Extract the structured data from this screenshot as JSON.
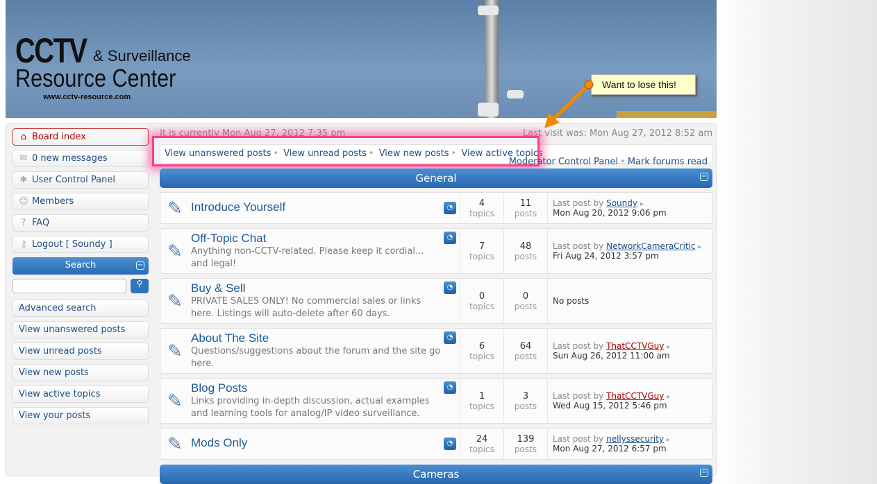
{
  "header": {
    "logo_line1": "CCTV",
    "logo_line1b": "& Surveillance",
    "logo_line2": "Resource Center",
    "logo_url": "www.cctv-resource.com"
  },
  "annotation": {
    "note": "Want to lose this!"
  },
  "sidebar": {
    "items": [
      {
        "label": "Board index",
        "icon": "home-icon"
      },
      {
        "label": "0 new messages",
        "icon": "envelope-icon"
      },
      {
        "label": "User Control Panel",
        "icon": "gear-icon"
      },
      {
        "label": "Members",
        "icon": "user-icon"
      },
      {
        "label": "FAQ",
        "icon": "question-icon"
      },
      {
        "label": "Logout [ Soundy ]",
        "icon": "key-icon"
      }
    ],
    "search_title": "Search",
    "search_value": "",
    "links": [
      "Advanced search",
      "View unanswered posts",
      "View unread posts",
      "View new posts",
      "View active topics",
      "View your posts"
    ]
  },
  "main": {
    "current_time": "It is currently Mon Aug 27, 2012 7:35 pm",
    "last_visit": "Last visit was: Mon Aug 27, 2012 8:52 am",
    "quick_links": [
      "View unanswered posts",
      "View unread posts",
      "View new posts",
      "View active topics"
    ],
    "mod_links": [
      "Moderator Control Panel",
      "Mark forums read"
    ],
    "categories": [
      {
        "title": "General",
        "forums": [
          {
            "title": "Introduce Yourself",
            "desc": "",
            "topics": "4",
            "posts": "11",
            "by": "Soundy",
            "date": "Mon Aug 20, 2012 9:06 pm",
            "red": false
          },
          {
            "title": "Off-Topic Chat",
            "desc": "Anything non-CCTV-related. Please keep it cordial... and legal!",
            "topics": "7",
            "posts": "48",
            "by": "NetworkCameraCritic",
            "date": "Fri Aug 24, 2012 3:57 pm",
            "red": false
          },
          {
            "title": "Buy & Sell",
            "desc": "PRIVATE SALES ONLY! No commercial sales or links here. Listings will auto-delete after 60 days.",
            "topics": "0",
            "posts": "0",
            "by": "",
            "date": "",
            "red": false
          },
          {
            "title": "About The Site",
            "desc": "Questions/suggestions about the forum and the site go here.",
            "topics": "6",
            "posts": "64",
            "by": "ThatCCTVGuy",
            "date": "Sun Aug 26, 2012 11:00 am",
            "red": true
          },
          {
            "title": "Blog Posts",
            "desc": "Links providing in-depth discussion, actual examples and learning tools for analog/IP video surveillance.",
            "topics": "1",
            "posts": "3",
            "by": "ThatCCTVGuy",
            "date": "Wed Aug 15, 2012 5:46 pm",
            "red": true
          },
          {
            "title": "Mods Only",
            "desc": "",
            "topics": "24",
            "posts": "139",
            "by": "nellyssecurity",
            "date": "Mon Aug 27, 2012 6:57 pm",
            "red": false
          }
        ]
      },
      {
        "title": "Cameras",
        "forums": []
      }
    ],
    "labels": {
      "topics": "topics",
      "posts": "posts",
      "last_post_by": "Last post by",
      "no_posts": "No posts"
    }
  }
}
